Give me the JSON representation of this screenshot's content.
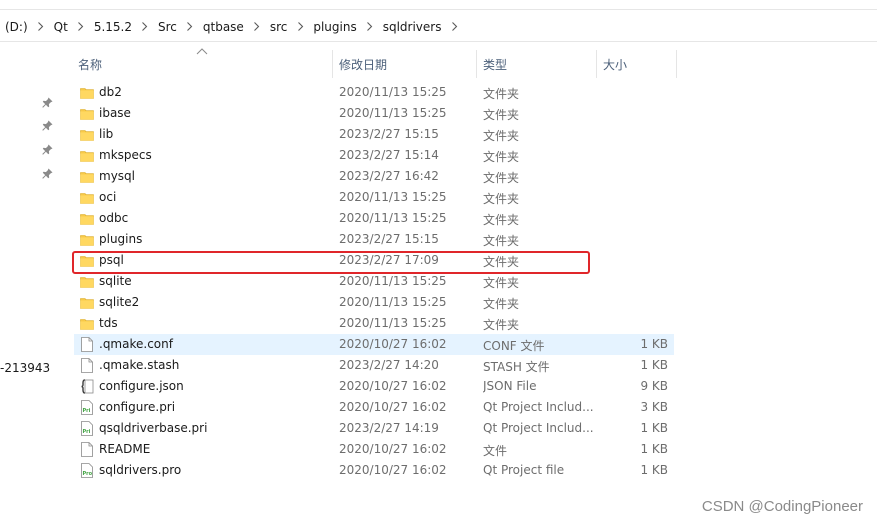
{
  "breadcrumb": [
    "(D:)",
    "Qt",
    "5.15.2",
    "Src",
    "qtbase",
    "src",
    "plugins",
    "sqldrivers"
  ],
  "nav_pane": {
    "partial_item_text": "-213943"
  },
  "columns": {
    "name": "名称",
    "date": "修改日期",
    "type": "类型",
    "size": "大小"
  },
  "files": [
    {
      "name": "db2",
      "date": "2020/11/13 15:25",
      "type": "文件夹",
      "size": "",
      "icon": "folder-icon"
    },
    {
      "name": "ibase",
      "date": "2020/11/13 15:25",
      "type": "文件夹",
      "size": "",
      "icon": "folder-icon"
    },
    {
      "name": "lib",
      "date": "2023/2/27 15:15",
      "type": "文件夹",
      "size": "",
      "icon": "folder-icon"
    },
    {
      "name": "mkspecs",
      "date": "2023/2/27 15:14",
      "type": "文件夹",
      "size": "",
      "icon": "folder-icon"
    },
    {
      "name": "mysql",
      "date": "2023/2/27 16:42",
      "type": "文件夹",
      "size": "",
      "icon": "folder-icon"
    },
    {
      "name": "oci",
      "date": "2020/11/13 15:25",
      "type": "文件夹",
      "size": "",
      "icon": "folder-icon"
    },
    {
      "name": "odbc",
      "date": "2020/11/13 15:25",
      "type": "文件夹",
      "size": "",
      "icon": "folder-icon"
    },
    {
      "name": "plugins",
      "date": "2023/2/27 15:15",
      "type": "文件夹",
      "size": "",
      "icon": "folder-icon"
    },
    {
      "name": "psql",
      "date": "2023/2/27 17:09",
      "type": "文件夹",
      "size": "",
      "icon": "folder-icon"
    },
    {
      "name": "sqlite",
      "date": "2020/11/13 15:25",
      "type": "文件夹",
      "size": "",
      "icon": "folder-icon"
    },
    {
      "name": "sqlite2",
      "date": "2020/11/13 15:25",
      "type": "文件夹",
      "size": "",
      "icon": "folder-icon"
    },
    {
      "name": "tds",
      "date": "2020/11/13 15:25",
      "type": "文件夹",
      "size": "",
      "icon": "folder-icon"
    },
    {
      "name": ".qmake.conf",
      "date": "2020/10/27 16:02",
      "type": "CONF 文件",
      "size": "1 KB",
      "icon": "file-icon"
    },
    {
      "name": ".qmake.stash",
      "date": "2023/2/27 14:20",
      "type": "STASH 文件",
      "size": "1 KB",
      "icon": "file-icon"
    },
    {
      "name": "configure.json",
      "date": "2020/10/27 16:02",
      "type": "JSON File",
      "size": "9 KB",
      "icon": "json-file-icon"
    },
    {
      "name": "configure.pri",
      "date": "2020/10/27 16:02",
      "type": "Qt Project Includ...",
      "size": "3 KB",
      "icon": "qt-pri-file-icon"
    },
    {
      "name": "qsqldriverbase.pri",
      "date": "2023/2/27 14:19",
      "type": "Qt Project Includ...",
      "size": "1 KB",
      "icon": "qt-pri-file-icon"
    },
    {
      "name": "README",
      "date": "2020/10/27 16:02",
      "type": "文件",
      "size": "1 KB",
      "icon": "file-icon"
    },
    {
      "name": "sqldrivers.pro",
      "date": "2020/10/27 16:02",
      "type": "Qt Project file",
      "size": "1 KB",
      "icon": "qt-pro-file-icon"
    }
  ],
  "hovered_row": 12,
  "highlighted_row": 8,
  "watermark": "CSDN @CodingPioneer",
  "colors": {
    "folder": "#f7c948",
    "highlight": "#e0262a",
    "hover": "#e5f3ff",
    "header_text": "#4c607a"
  }
}
